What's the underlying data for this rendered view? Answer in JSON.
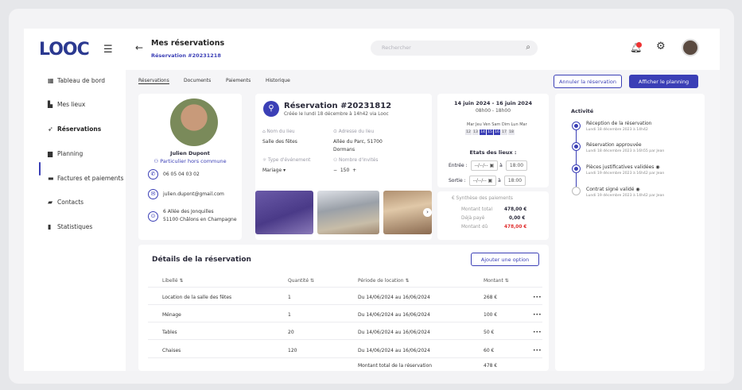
{
  "header": {
    "logo": "LOOC",
    "title": "Mes réservations",
    "subtitle": "Réservation #20231218",
    "search_placeholder": "Rechercher"
  },
  "sidebar": {
    "items": [
      {
        "label": "Tableau de bord",
        "icon": "dashboard-icon"
      },
      {
        "label": "Mes lieux",
        "icon": "building-icon"
      },
      {
        "label": "Réservations",
        "icon": "pin-icon",
        "active": true
      },
      {
        "label": "Planning",
        "icon": "calendar-icon"
      },
      {
        "label": "Factures et paiements",
        "icon": "invoice-icon"
      },
      {
        "label": "Contacts",
        "icon": "contacts-icon"
      },
      {
        "label": "Statistiques",
        "icon": "stats-icon"
      }
    ]
  },
  "tabs": [
    {
      "label": "Réservations",
      "active": true
    },
    {
      "label": "Documents"
    },
    {
      "label": "Paiements"
    },
    {
      "label": "Historique"
    }
  ],
  "actions": {
    "cancel": "Annuler la réservation",
    "planning": "Afficher le planning"
  },
  "client": {
    "name": "Julien Dupont",
    "type": "Particulier hors commune",
    "phone": "06 05 04 03 02",
    "email": "julien.dupont@gmail.com",
    "address_line1": "6 Allée des Jonquilles",
    "address_line2": "51100 Châlons en Champagne"
  },
  "reservation": {
    "title": "Réservation #20231812",
    "created": "Créée le lundi 18 décembre à 14h42 via Looc",
    "venue_label": "Nom du lieu",
    "venue": "Salle des fêtes",
    "address_label": "Adresse du lieu",
    "address_1": "Allée du Parc, 51700",
    "address_2": "Dormans",
    "event_label": "Type d'événement",
    "event": "Mariage",
    "guests_label": "Nombre d'invités",
    "guests": "150",
    "minus": "−",
    "plus": "+"
  },
  "dates": {
    "range": "14 juin 2024 - 16 juin 2024",
    "hours": "08h00 - 18h00",
    "days": "Mar Jeu Ven Sam Dim Lun Mar",
    "day_numbers": [
      "12",
      "13",
      "14",
      "15",
      "16",
      "17",
      "18"
    ],
    "selected": [
      2,
      3,
      4
    ],
    "etat_title": "Etats des lieux :",
    "entry_label": "Entrée :",
    "exit_label": "Sortie :",
    "date_ph": "--/--/--",
    "at": "à",
    "entry_time": "18:00",
    "exit_time": "18:00"
  },
  "payments": {
    "title": "Synthèse des paiements",
    "rows": [
      {
        "label": "Montant total",
        "value": "478,00 €"
      },
      {
        "label": "Déjà payé",
        "value": "0,00 €"
      },
      {
        "label": "Montant dû",
        "value": "478,00 €"
      }
    ],
    "due_color": "#e03030"
  },
  "details": {
    "title": "Détails de la réservation",
    "add_option": "Ajouter une option",
    "headers": {
      "label": "Libellé",
      "qty": "Quantité",
      "period": "Période de location",
      "amount": "Montant"
    },
    "rows": [
      {
        "label": "Location de la salle des fêtes",
        "qty": "1",
        "period": "Du 14/06/2024 au 16/06/2024",
        "amount": "268 €"
      },
      {
        "label": "Ménage",
        "qty": "1",
        "period": "Du 14/06/2024 au 16/06/2024",
        "amount": "100 €"
      },
      {
        "label": "Tables",
        "qty": "20",
        "period": "Du 14/06/2024 au 16/06/2024",
        "amount": "50 €"
      },
      {
        "label": "Chaises",
        "qty": "120",
        "period": "Du 14/06/2024 au 16/06/2024",
        "amount": "60 €"
      }
    ],
    "total_label": "Montant total de la réservation",
    "total": "478 €",
    "more": "•••"
  },
  "activity": {
    "title": "Activité",
    "events": [
      {
        "title": "Réception de la réservation",
        "date": "Lundi 18 décembre 2023 à 14h42",
        "done": true
      },
      {
        "title": "Réservation approuvée",
        "date": "Lundi 18 décembre 2023 à 16h55 par Jean",
        "done": true
      },
      {
        "title": "Pièces justificatives validées",
        "date": "Lundi 19 décembre 2023 à 16h42 par Jean",
        "done": true
      },
      {
        "title": "Contrat signé validé",
        "date": "Lundi 19 décembre 2023 à 14h42 par Jean",
        "done": false
      }
    ]
  },
  "colors": {
    "accent": "#3b3fb6",
    "danger": "#e03030"
  }
}
